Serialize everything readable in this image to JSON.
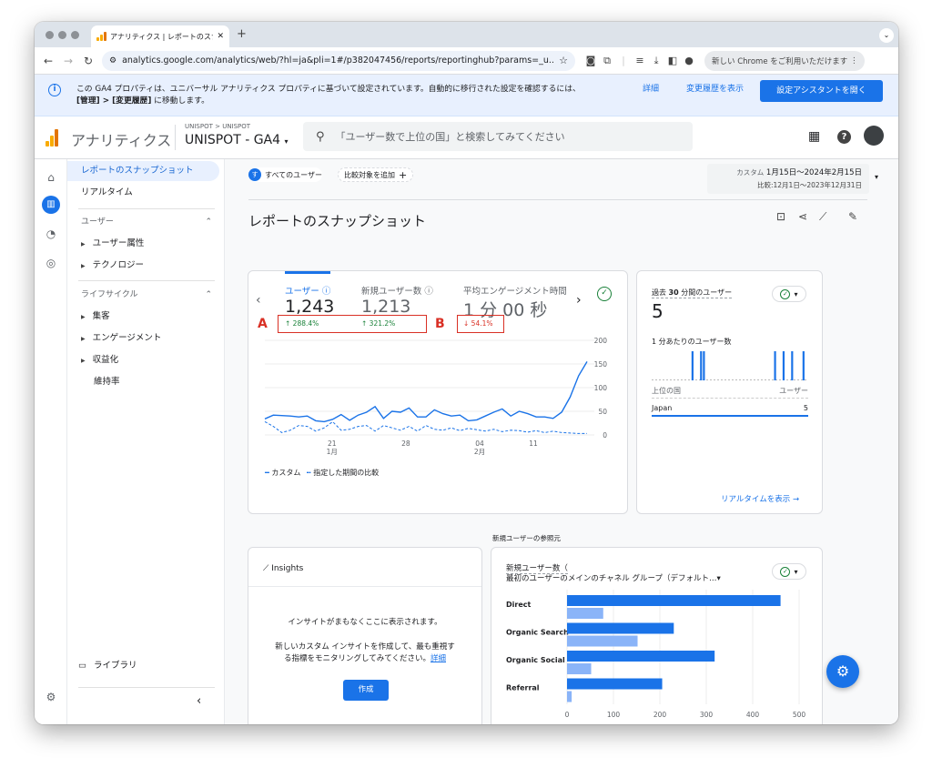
{
  "browser": {
    "tab_title": "アナリティクス | レポートのスナ",
    "url": "analytics.google.com/analytics/web/?hl=ja&pli=1#/p382047456/reports/reportinghub?params=_u..nav%3D...",
    "chrome_update": "新しい Chrome をご利用いただけます"
  },
  "banner": {
    "message_line1": "この GA4 プロパティは、ユニバーサル アナリティクス プロパティに基づいて設定されています。自動的に移行された設定を確認するには、",
    "message_bold": "[管理] > [変更履歴]",
    "message_tail": " に移動します。",
    "details": "詳細",
    "history": "変更履歴を表示",
    "open_assistant": "設定アシスタントを開く"
  },
  "header": {
    "product": "アナリティクス",
    "breadcrumb": "UNISPOT > UNISPOT",
    "property": "UNISPOT - GA4",
    "search_placeholder": "「ユーザー数で上位の国」と検索してみてください"
  },
  "leftnav": {
    "snapshot": "レポートのスナップショット",
    "realtime": "リアルタイム",
    "users_section": "ユーザー",
    "user_attributes": "ユーザー属性",
    "technology": "テクノロジー",
    "lifecycle_section": "ライフサイクル",
    "acquisition": "集客",
    "engagement": "エンゲージメント",
    "monetization": "収益化",
    "retention": "維持率",
    "library": "ライブラリ"
  },
  "filters": {
    "segment_initial": "す",
    "segment": "すべてのユーザー",
    "add_comparison": "比較対象を追加"
  },
  "daterange": {
    "label": "カスタム",
    "range": "1月15日〜2024年2月15日",
    "compare": "比較:12月1日〜2023年12月31日"
  },
  "page_title": "レポートのスナップショット",
  "summary": {
    "metrics": [
      {
        "label": "ユーザー",
        "value": "1,243",
        "change": "288.4%",
        "direction": "up"
      },
      {
        "label": "新規ユーザー数",
        "value": "1,213",
        "change": "321.2%",
        "direction": "up"
      },
      {
        "label": "平均エンゲージメント時間",
        "value": "1 分 00 秒",
        "change": "54.1%",
        "direction": "down"
      }
    ],
    "annotation_a": "A",
    "annotation_b": "B",
    "legend_custom": "カスタム",
    "legend_compare": "指定した期間の比較"
  },
  "chart_data": [
    {
      "type": "line",
      "x_ticks": [
        "21 1月",
        "28",
        "04 2月",
        "11"
      ],
      "ylim": [
        0,
        200
      ],
      "y_ticks": [
        0,
        50,
        100,
        150,
        200
      ],
      "series": [
        {
          "name": "カスタム",
          "values": [
            34,
            42,
            41,
            40,
            38,
            40,
            30,
            28,
            33,
            43,
            31,
            42,
            48,
            60,
            35,
            50,
            48,
            57,
            38,
            38,
            53,
            45,
            40,
            42,
            30,
            32,
            40,
            48,
            55,
            40,
            50,
            45,
            38,
            38,
            35,
            48,
            80,
            125,
            155
          ]
        },
        {
          "name": "指定した期間の比較",
          "values": [
            28,
            18,
            5,
            10,
            20,
            18,
            8,
            15,
            28,
            10,
            12,
            18,
            20,
            8,
            20,
            15,
            10,
            18,
            8,
            20,
            12,
            10,
            15,
            9,
            14,
            11,
            8,
            12,
            7,
            10,
            9,
            6,
            9,
            5,
            8,
            5,
            4,
            3,
            3
          ]
        }
      ],
      "colors": [
        "#1a73e8",
        "#1a73e8"
      ]
    },
    {
      "type": "bar",
      "title": "1 分あたりのユーザー数",
      "values": [
        0,
        0,
        0,
        0,
        0,
        0,
        0,
        0,
        0,
        0,
        0,
        0,
        0,
        0,
        1,
        0,
        0,
        1,
        1,
        0,
        0,
        0,
        0,
        0,
        0,
        0,
        0,
        0,
        0,
        0,
        0,
        0,
        0,
        0,
        0,
        0,
        0,
        0,
        0,
        0,
        0,
        0,
        0,
        1,
        0,
        0,
        1,
        0,
        0,
        1,
        0,
        0,
        0,
        1,
        0
      ]
    },
    {
      "type": "bar",
      "orientation": "horizontal",
      "categories": [
        "Direct",
        "Organic Search",
        "Organic Social",
        "Referral"
      ],
      "series": [
        {
          "name": "カスタム",
          "values": [
            460,
            230,
            318,
            205
          ]
        },
        {
          "name": "指定した期間の比較",
          "values": [
            78,
            152,
            52,
            10
          ]
        }
      ],
      "xlim": [
        0,
        500
      ],
      "x_ticks": [
        0,
        100,
        200,
        300,
        400,
        500
      ],
      "colors": [
        "#1a73e8",
        "#8ab4f8"
      ]
    }
  ],
  "realtime": {
    "label_prefix": "過去 ",
    "label_bold": "30",
    "label_suffix": " 分間のユーザー",
    "value": "5",
    "per_minute": "1 分あたりのユーザー数",
    "top_country": "上位の国",
    "users_col": "ユーザー",
    "country": "Japan",
    "country_users": "5",
    "view_realtime": "リアルタイムを表示"
  },
  "insights": {
    "title": "Insights",
    "line1": "インサイトがまもなくここに表示されます。",
    "line2": "新しいカスタム インサイトを作成して、最も重視す",
    "line3": "る指標をモニタリングしてみてください。",
    "detail_link": "詳細",
    "create": "作成"
  },
  "acquisition": {
    "section_label": "新規ユーザーの参照元",
    "title1": "新規ユーザー数（",
    "title2": "最初のユーザーのメインのチャネル グループ（デフォルト…"
  }
}
